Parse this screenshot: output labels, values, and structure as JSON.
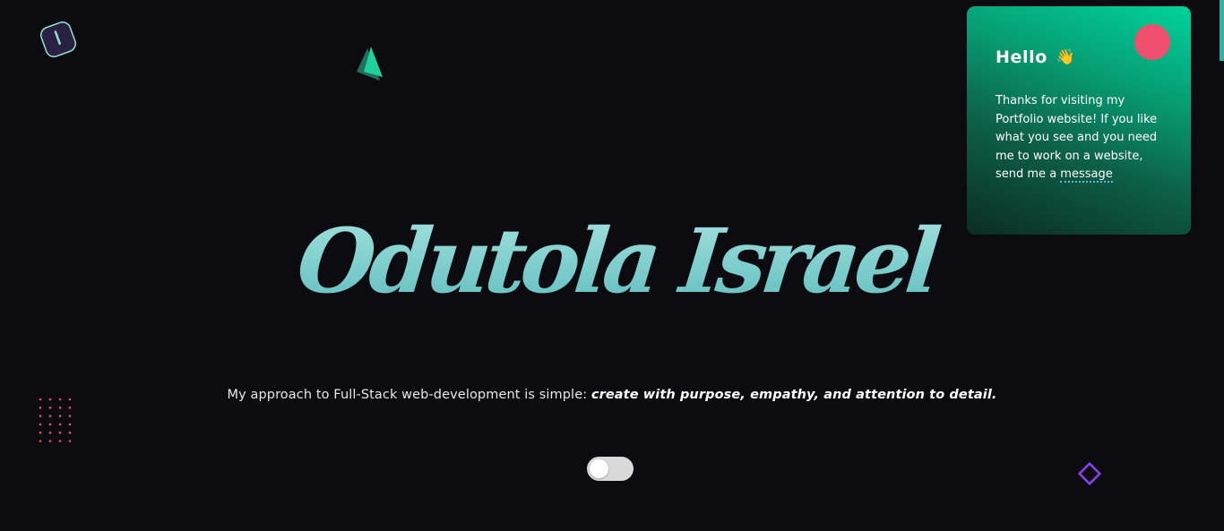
{
  "logo": {
    "icon": "logo-icon"
  },
  "hero": {
    "name": "Odutola Israel",
    "name_color_top": "#9edfdc",
    "name_color_bottom": "#5fbcbc"
  },
  "tagline": {
    "plain": "My approach to Full-Stack web-development is simple: ",
    "emphasis": "create with purpose, empathy, and attention to detail."
  },
  "theme_toggle": {
    "state": "off"
  },
  "greeting_card": {
    "title": "Hello",
    "wave_emoji": "👋",
    "message": "Thanks for visiting my Portfolio website! If you like what you see and you need me to work on a website, send me a ",
    "link_text": "message",
    "accent": "#00d39a",
    "badge_color": "#f0506e"
  },
  "decor": {
    "triangle_color": "#1fcf9c",
    "dots_color": "#f0506e",
    "diamond_color": "#8a3ff0"
  }
}
